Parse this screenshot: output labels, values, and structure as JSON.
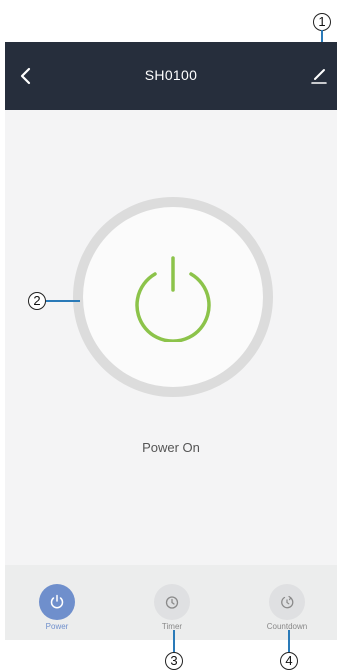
{
  "header": {
    "title": "SH0100"
  },
  "main": {
    "status": "Power On"
  },
  "tabs": [
    {
      "label": "Power",
      "icon": "power-icon",
      "active": true
    },
    {
      "label": "Timer",
      "icon": "timer-icon",
      "active": false
    },
    {
      "label": "Countdown",
      "icon": "countdown-icon",
      "active": false
    }
  ],
  "callouts": [
    "1",
    "2",
    "3",
    "4"
  ],
  "colors": {
    "header_bg": "#262e3c",
    "power_green": "#8cc34a",
    "active_tab": "#6f8fcc"
  }
}
